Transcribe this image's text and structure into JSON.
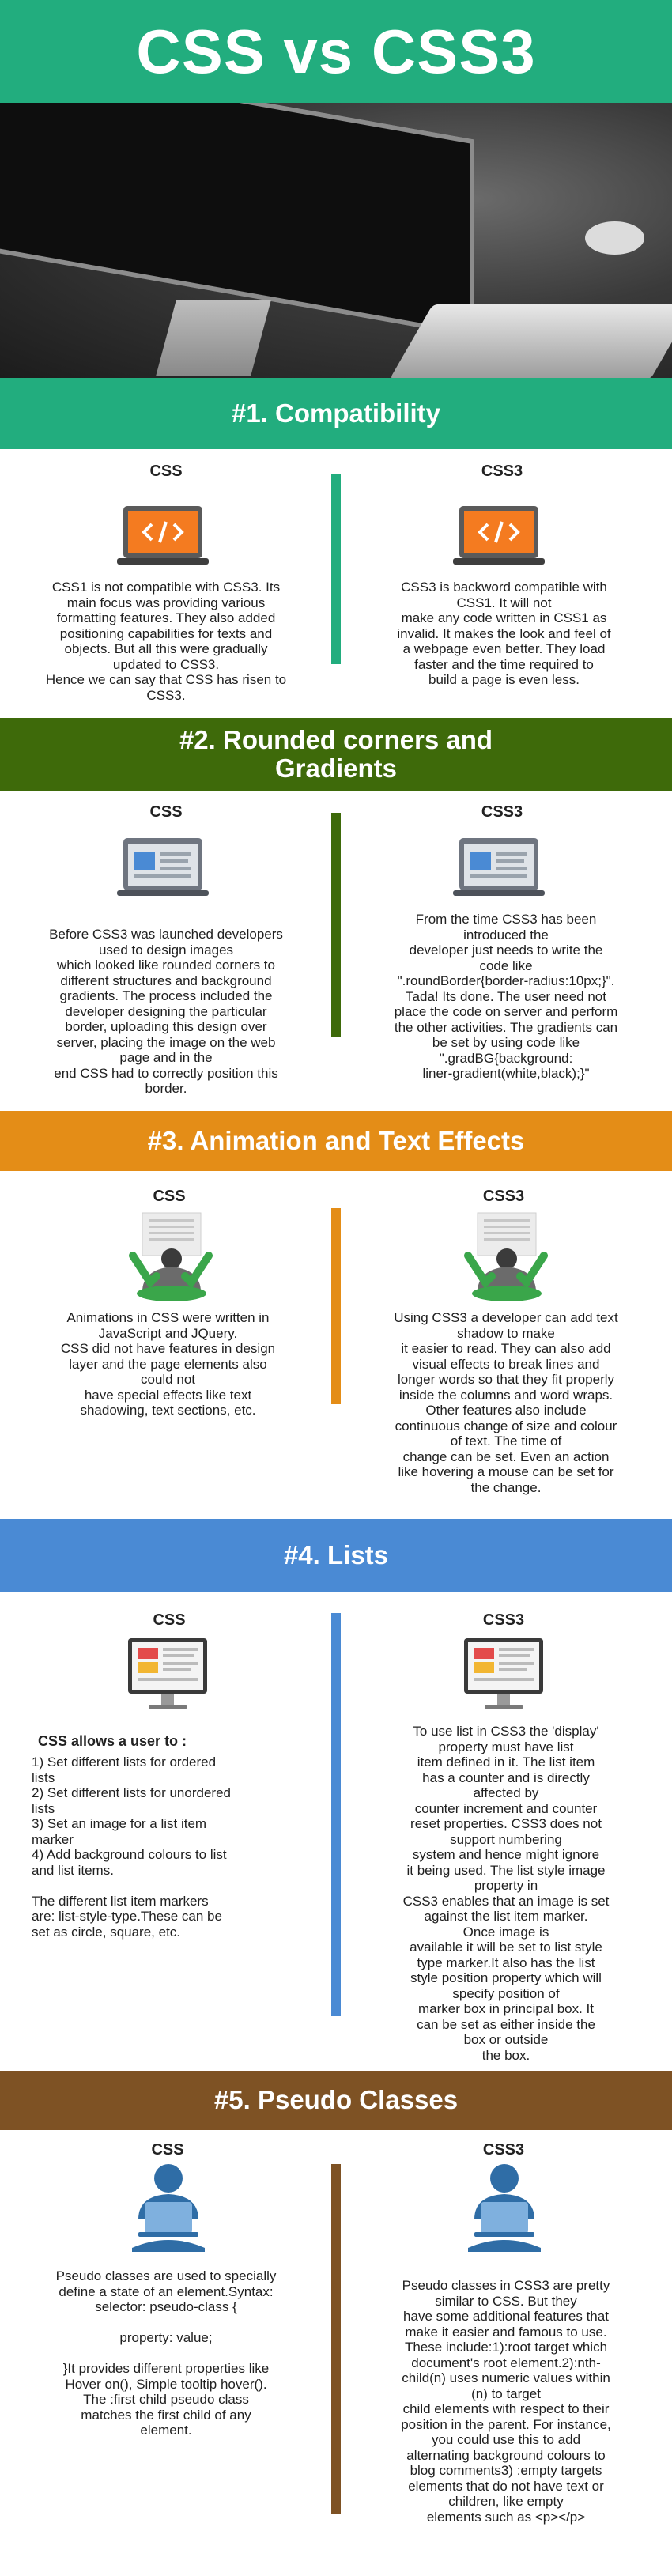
{
  "title": "CSS vs CSS3",
  "colors": {
    "green_teal": "#22ad7e",
    "dark_green": "#3e6a0a",
    "orange": "#e48d17",
    "blue": "#4a8ad4",
    "brown": "#7e5224",
    "laptop_orange": "#f47b20"
  },
  "sections": [
    {
      "heading": "#1. Compatibility",
      "css_label": "CSS",
      "css3_label": "CSS3",
      "css_icon": "code-laptop-icon",
      "css_text": "CSS1 is not compatible with CSS3. Its\nmain focus was providing various\nformatting features. They also added\npositioning capabilities for texts and\nobjects. But all this were gradually\nupdated to CSS3.\nHence we can say that CSS has risen to\nCSS3.",
      "css3_text": "CSS3 is backword compatible with\nCSS1. It will not\nmake any code written in CSS1 as\ninvalid. It makes the look and feel of\na webpage even better. They load\nfaster and the time required to\nbuild a page is even less."
    },
    {
      "heading": "#2. Rounded corners and\nGradients",
      "css_label": "CSS",
      "css3_label": "CSS3",
      "css_icon": "browser-window-icon",
      "css_text": "Before CSS3 was launched developers\nused to design images\nwhich looked like rounded corners to\ndifferent structures and background\ngradients. The process included the\ndeveloper designing the particular\nborder, uploading this design over\nserver, placing the image on the web\npage and in the\nend CSS had to correctly position this\nborder.",
      "css3_text": "From the time CSS3 has been\nintroduced the\ndeveloper just needs to write the\ncode like\n\".roundBorder{border-radius:10px;}\".\nTada! Its done. The user need not\nplace the code on server and perform\nthe other activities. The gradients can\nbe set by using code like\n\".gradBG{background:\nliner-gradient(white,black);}\""
    },
    {
      "heading": "#3. Animation and Text Effects",
      "css_label": "CSS",
      "css3_label": "CSS3",
      "css_icon": "person-reading-icon",
      "css_text": "Animations in CSS were written in\nJavaScript and JQuery.\nCSS did not have features in design\nlayer and the page elements also\ncould not\nhave special effects like text\nshadowing, text sections, etc.",
      "css3_text": "Using CSS3 a developer can add text\nshadow to make\nit easier to read. They can also add\nvisual effects to break lines and\nlonger words so that they fit properly\ninside the columns and word wraps.\nOther features also include\ncontinuous change of size and colour\nof text. The time of\nchange can be set. Even an action\nlike hovering a mouse can be set for\nthe change."
    },
    {
      "heading": "#4. Lists",
      "css_label": "CSS",
      "css3_label": "CSS3",
      "css_icon": "desktop-monitor-icon",
      "css_list_heading": "CSS allows a user to :",
      "css_text": "1) Set different lists for ordered\nlists\n2) Set different lists for unordered\nlists\n3) Set an image for a list item\nmarker\n4) Add background colours to list\nand list items.\n\nThe different list item markers\nare: list-style-type.These can be\nset as circle, square, etc.",
      "css3_text": "To use list in CSS3 the 'display'\nproperty must have list\nitem defined in it. The list item\nhas a counter and is directly\naffected by\ncounter increment and counter\nreset properties. CSS3 does not\nsupport numbering\nsystem and hence might ignore\nit being used. The list style image\nproperty in\nCSS3 enables that an image is set\nagainst the list item marker.\nOnce image is\navailable it will be set to list style\ntype marker.It also has the list\nstyle position property which will\nspecify position of\nmarker box in principal box. It\ncan be set as either inside the\nbox or outside\nthe box."
    },
    {
      "heading": "#5. Pseudo Classes",
      "css_label": "CSS",
      "css3_label": "CSS3",
      "css_icon": "person-laptop-icon",
      "css_text": "Pseudo classes are used to specially\ndefine a state of an element.Syntax:\nselector: pseudo-class {\n\nproperty: value;\n\n}It provides different properties like\nHover on(), Simple tooltip hover().\nThe :first child pseudo class\nmatches the first child of any\nelement.",
      "css3_text": "Pseudo classes in CSS3 are pretty\nsimilar to CSS. But they\nhave some additional features that\nmake it easier and famous to use.\nThese include:1):root target which\ndocument's root element.2):nth-\nchild(n) uses numeric values within\n(n) to target\nchild elements with respect to their\nposition in the parent. For instance,\nyou could use this to add\nalternating background colours to\nblog comments3) :empty targets\nelements that do not have text or\nchildren, like empty\nelements such as <p></p>"
    }
  ]
}
